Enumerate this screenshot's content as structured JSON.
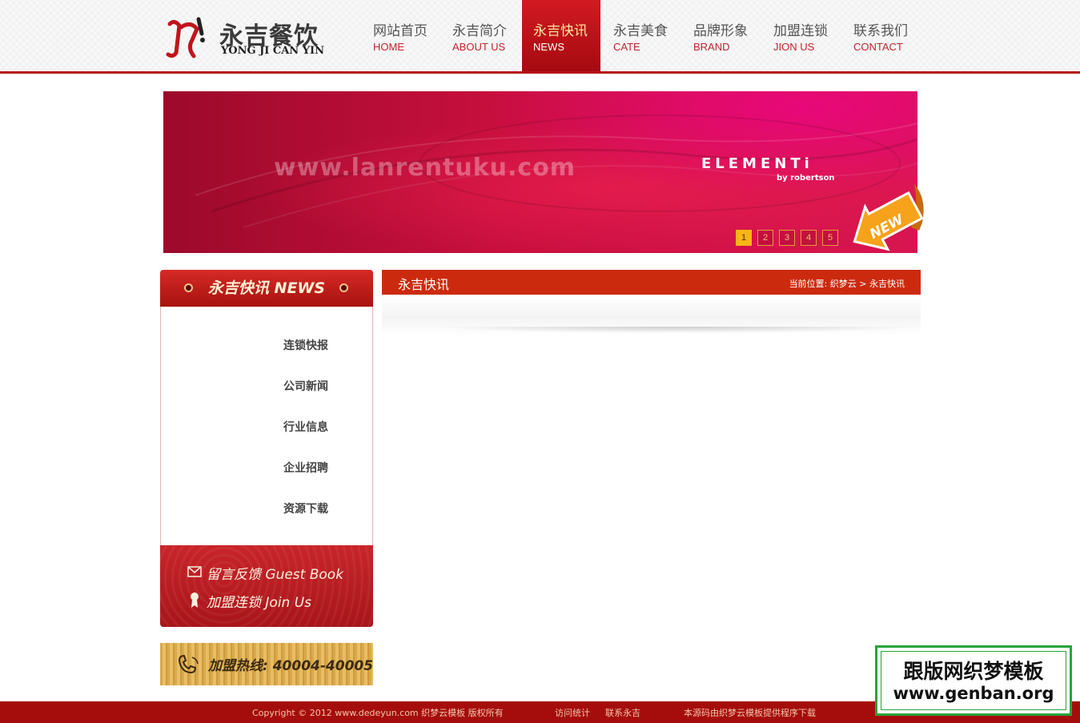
{
  "logo": {
    "cn": "永吉餐饮",
    "en": "YONG JI CAN YIN"
  },
  "nav": [
    {
      "cn": "网站首页",
      "en": "HOME"
    },
    {
      "cn": "永吉简介",
      "en": "ABOUT US"
    },
    {
      "cn": "永吉快讯",
      "en": "NEWS"
    },
    {
      "cn": "永吉美食",
      "en": "CATE"
    },
    {
      "cn": "品牌形象",
      "en": "BRAND"
    },
    {
      "cn": "加盟连锁",
      "en": "JION US"
    },
    {
      "cn": "联系我们",
      "en": "CONTACT"
    }
  ],
  "nav_active_index": 2,
  "banner": {
    "url": "www.lanrentuku.com",
    "brand": "ELEMENTi",
    "brand_sub": "by robertson",
    "pages": [
      "1",
      "2",
      "3",
      "4",
      "5"
    ],
    "current_page": "1",
    "badge": "NEW"
  },
  "sidebar": {
    "title": "永吉快讯 NEWS",
    "items": [
      "连锁快报",
      "公司新闻",
      "行业信息",
      "企业招聘",
      "资源下载"
    ],
    "guestbook": "留言反馈  Guest Book",
    "join": "加盟连锁  Join Us",
    "hotline": "加盟热线: 40004-40005"
  },
  "main": {
    "title": "永吉快讯",
    "crumb_label": "当前位置:",
    "crumb_home": "织梦云",
    "crumb_sep": ">",
    "crumb_current": "永吉快讯"
  },
  "footer": {
    "copyright": "Copyright © 2012 www.dedeyun.com 织梦云模板 版权所有",
    "stats": "访问统计",
    "contact": "联系永吉",
    "source": "本源码由织梦云模板提供程序下载"
  },
  "watermark": {
    "cn": "跟版网织梦模板",
    "en": "www.genban.org"
  },
  "colors": {
    "brand_red": "#b5151b",
    "accent_gold": "#f6b614",
    "title_bar": "#cc2a0e",
    "footer": "#a50d0d"
  }
}
